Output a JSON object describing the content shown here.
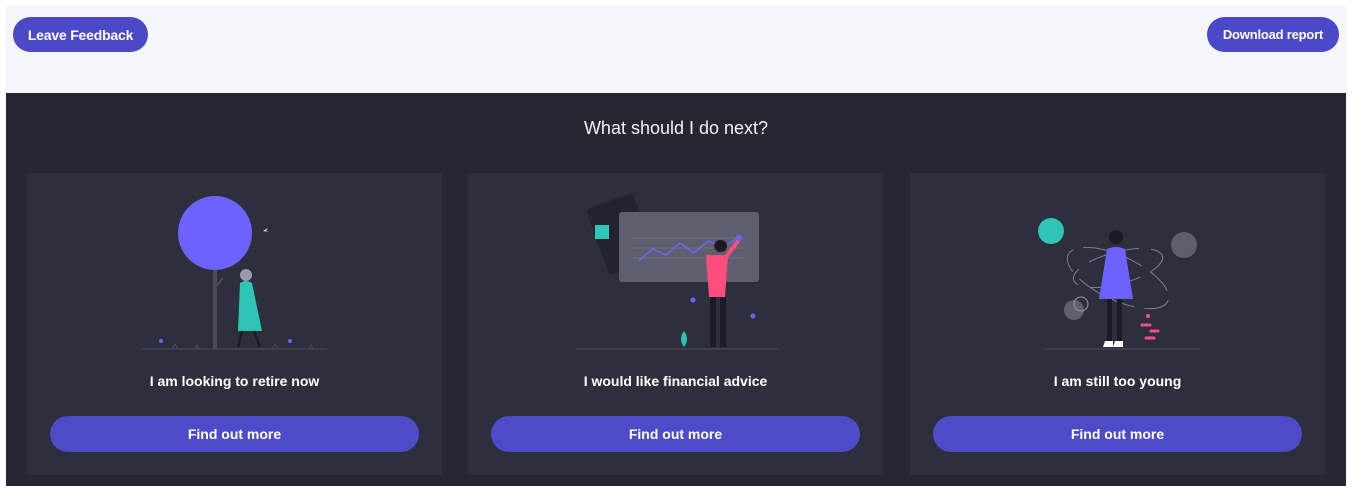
{
  "header": {
    "feedback_label": "Leave Feedback",
    "download_label": "Download report"
  },
  "section": {
    "title": "What should I do next?"
  },
  "cards": [
    {
      "heading": "I am looking to retire now",
      "button_label": "Find out more",
      "illustration": "person-walking-under-tree-illustration"
    },
    {
      "heading": "I would like financial advice",
      "button_label": "Find out more",
      "illustration": "person-pointing-at-chart-board-illustration"
    },
    {
      "heading": "I am still too young",
      "button_label": "Find out more",
      "illustration": "person-juggling-orbits-illustration"
    }
  ],
  "colors": {
    "accent": "#4b49c7",
    "panel_bg": "#262733",
    "card_bg": "#2d2f3c",
    "illus_purple": "#6c63ff",
    "illus_teal": "#2ec4b6",
    "illus_pink": "#ff4d7e"
  }
}
